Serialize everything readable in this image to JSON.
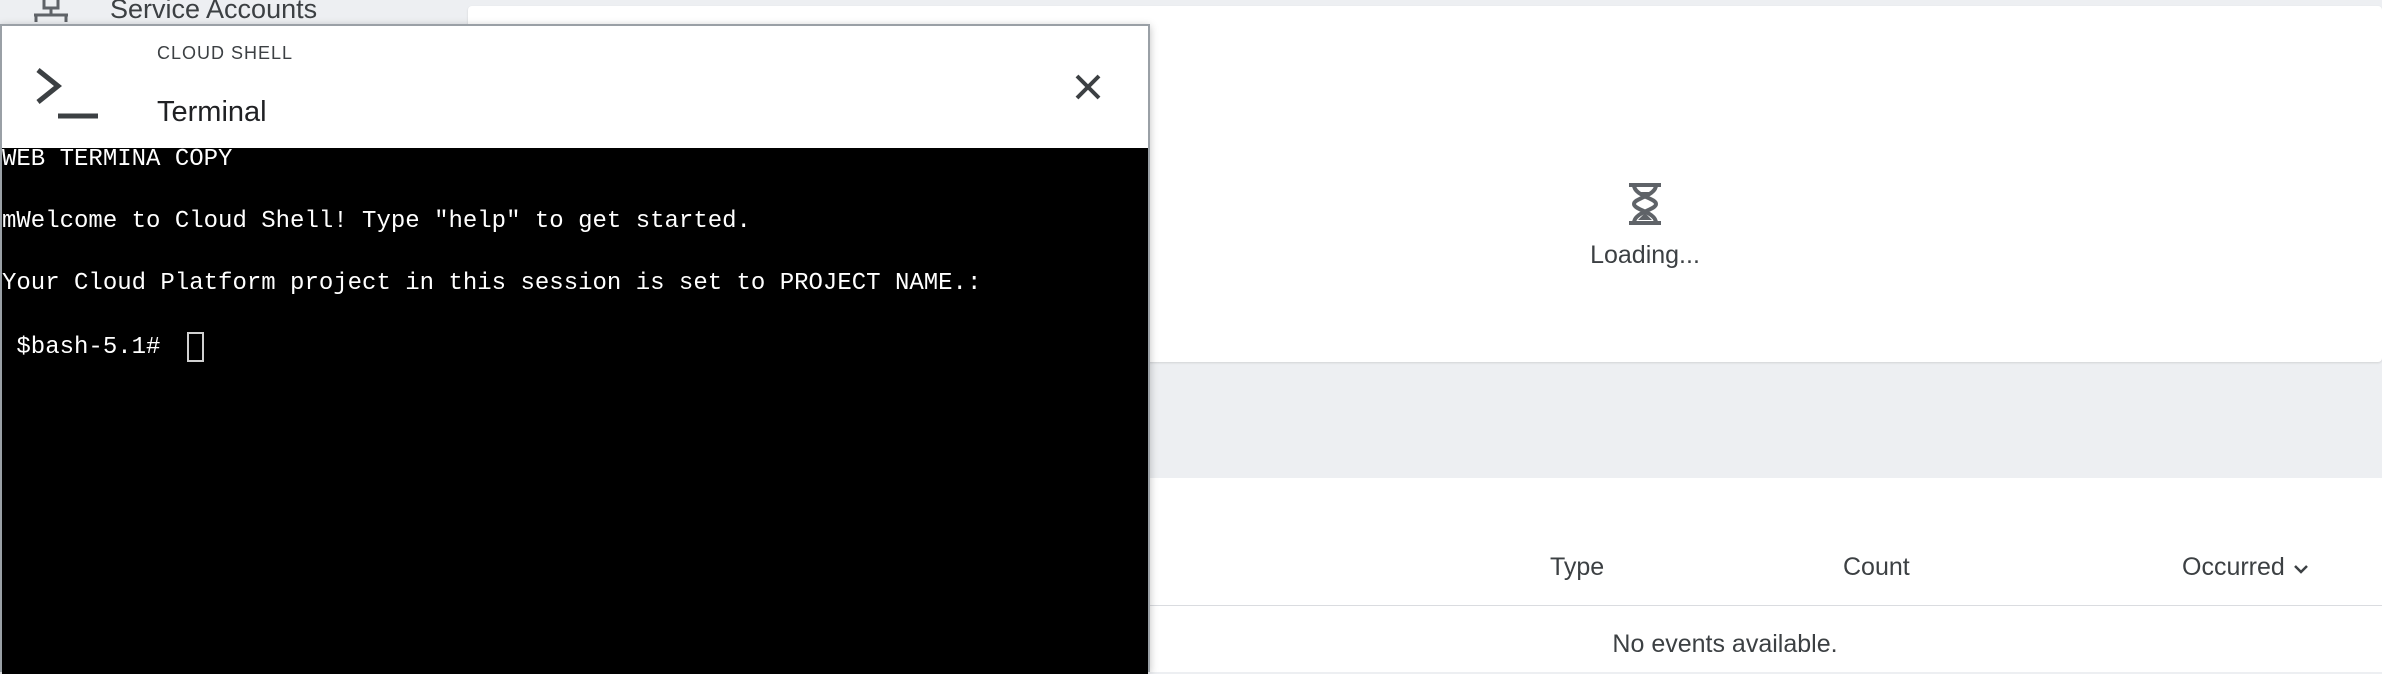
{
  "sidebar": {
    "item_label": "Service Accounts",
    "icon": "service-accounts-icon"
  },
  "loading": {
    "icon": "hourglass-icon",
    "text": "Loading..."
  },
  "events": {
    "columns": [
      "Type",
      "Count",
      "Occurred"
    ],
    "sort_icon": "chevron-down-icon",
    "empty_text": "No events available."
  },
  "shell": {
    "eyebrow": "CLOUD SHELL",
    "title": "Terminal",
    "icon": "terminal-icon",
    "close_icon": "close-icon",
    "lines": [
      "WEB TERMINA COPY",
      "mWelcome to Cloud Shell! Type \"help\" to get started.",
      "Your Cloud Platform project in this session is set to PROJECT NAME.:"
    ],
    "prompt": " $bash-5.1# "
  },
  "colors": {
    "terminal_bg": "#000000",
    "terminal_fg": "#ffffff",
    "page_bg": "#edeff2",
    "text_dark": "#3c4043"
  }
}
